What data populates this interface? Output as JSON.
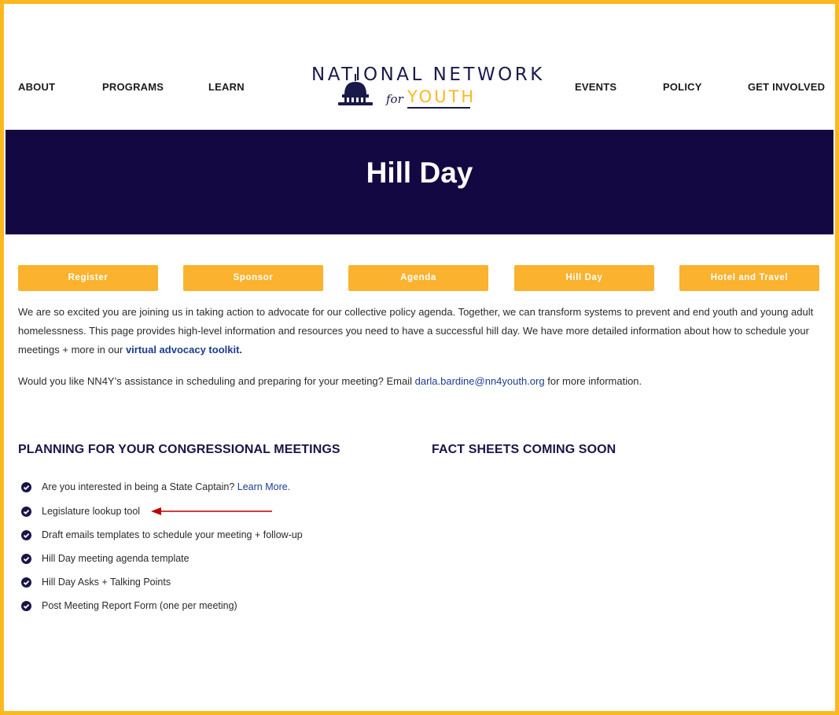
{
  "nav": {
    "left": [
      "ABOUT",
      "PROGRAMS",
      "LEARN"
    ],
    "right": [
      "EVENTS",
      "POLICY",
      "GET INVOLVED"
    ]
  },
  "logo": {
    "line1": "NATIONAL NETWORK",
    "for": "for",
    "youth": "YOUTH"
  },
  "banner": {
    "title": "Hill Day"
  },
  "tabs": [
    "Register",
    "Sponsor",
    "Agenda",
    "Hill Day",
    "Hotel and Travel"
  ],
  "intro": {
    "text": "We are so excited you are joining us in taking action to advocate for our collective policy agenda. Together, we can transform systems to prevent and end youth and young adult homelessness. This page provides high-level information and resources you need to have a successful hill day. We have more detailed information about how to schedule your meetings + more in our ",
    "link": "virtual advocacy toolkit."
  },
  "assist": {
    "before": "Would you like NN4Y’s assistance in scheduling and preparing for your meeting? Email ",
    "email": "darla.bardine@nn4youth.org",
    "after": " for more information."
  },
  "sections": {
    "planning": "PLANNING FOR YOUR CONGRESSIONAL MEETINGS",
    "facts": "FACT SHEETS COMING SOON"
  },
  "planning_items": {
    "item0_text": "Are you interested in being a State Captain? ",
    "item0_link": "Learn More.",
    "item1": "Legislature lookup tool",
    "item2": "Draft emails templates to schedule your meeting + follow-up",
    "item3": "Hill Day meeting agenda template",
    "item4": "Hill Day Asks + Talking Points",
    "item5": "Post Meeting Report Form (one per meeting)"
  },
  "colors": {
    "accent": "#fbb91f",
    "navy": "#140842",
    "link": "#1b3c8f",
    "arrow": "#c00000"
  }
}
